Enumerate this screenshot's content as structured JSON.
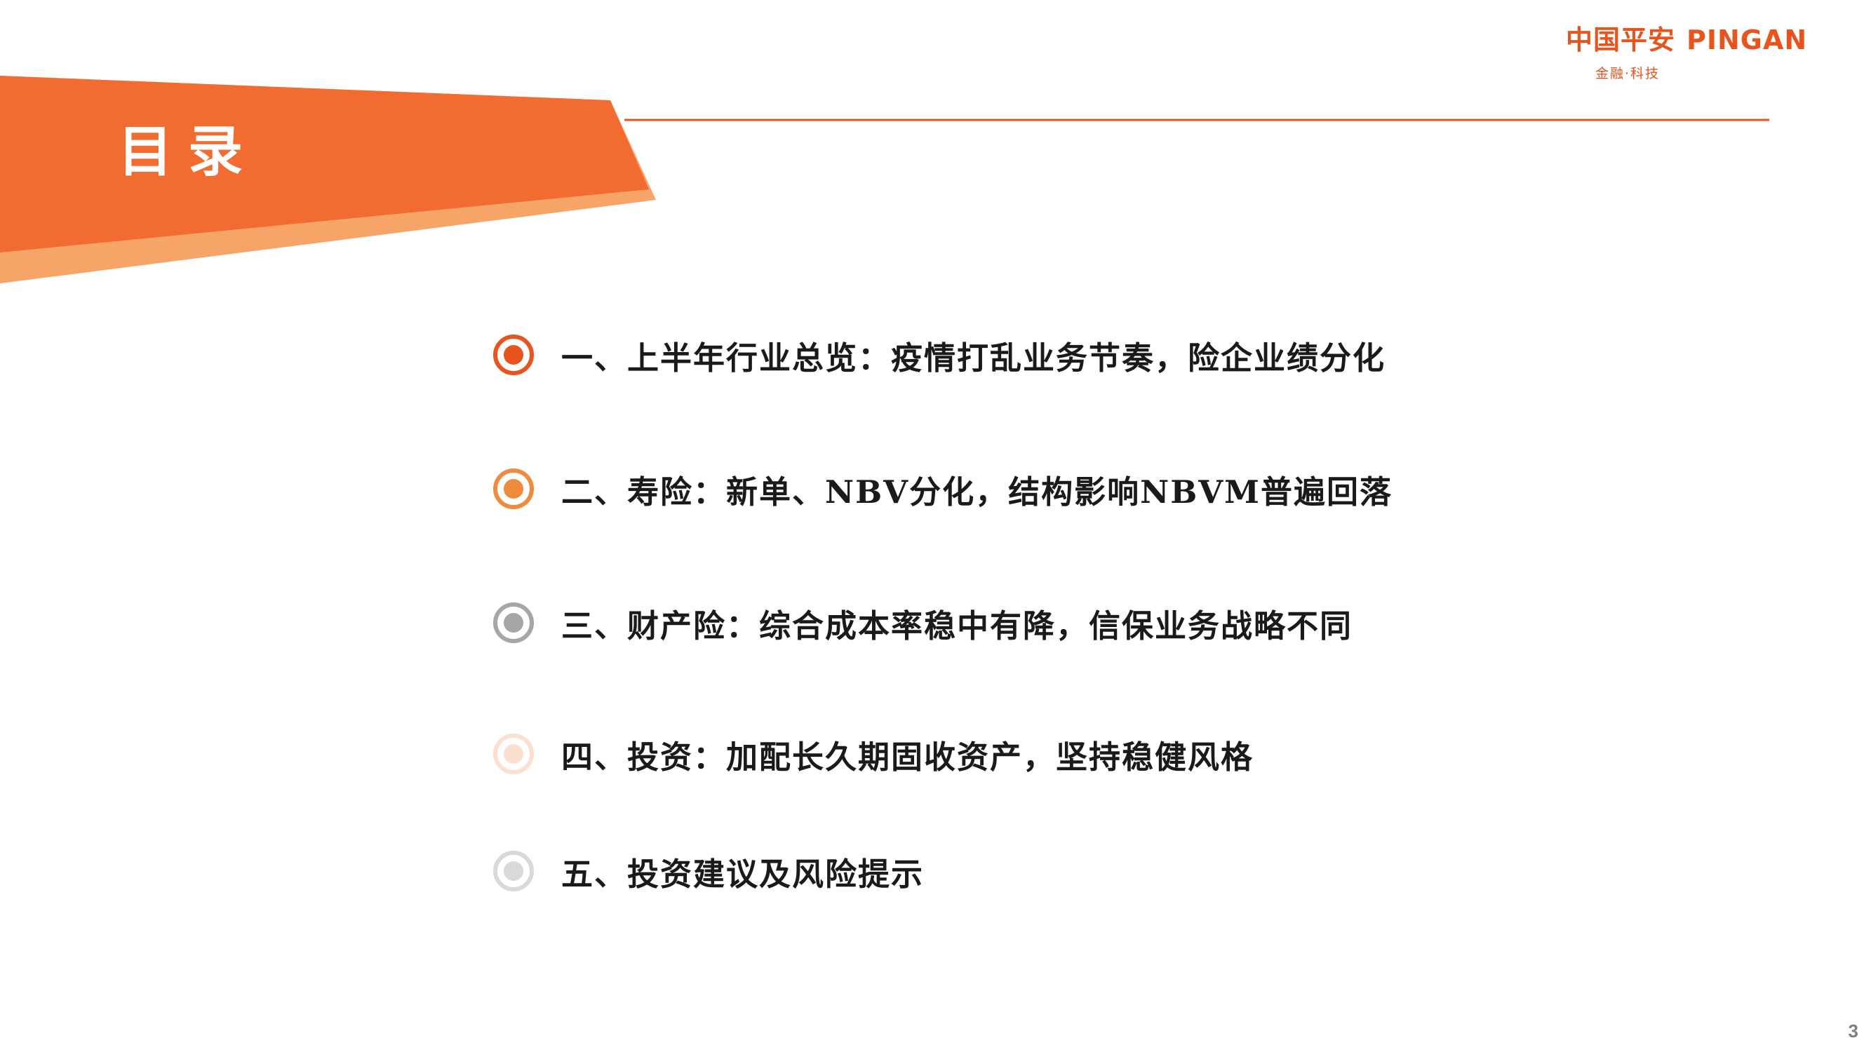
{
  "slide": {
    "title": "目录",
    "page_number": "3"
  },
  "logo": {
    "cn": "中国平安",
    "en": "PINGAN",
    "tagline": "金融·科技",
    "color": "#e8541e"
  },
  "colors": {
    "accent_orange": "#f26b30",
    "light_orange": "#f7a468",
    "divider": "#e8541e"
  },
  "toc": {
    "items": [
      {
        "label": "一、上半年行业总览：疫情打乱业务节奏，险企业绩分化",
        "ring_color": "#e8541e",
        "dot_color": "#e8541e"
      },
      {
        "label": "二、寿险：新单、NBV分化，结构影响NBVM普遍回落",
        "ring_color": "#f08a3c",
        "dot_color": "#f08a3c"
      },
      {
        "label": "三、财产险：综合成本率稳中有降，信保业务战略不同",
        "ring_color": "#a6a6a6",
        "dot_color": "#a6a6a6"
      },
      {
        "label": "四、投资：加配长久期固收资产，坚持稳健风格",
        "ring_color": "#fbe0cf",
        "dot_color": "#fbe0cf"
      },
      {
        "label": "五、投资建议及风险提示",
        "ring_color": "#d9d9d9",
        "dot_color": "#d9d9d9"
      }
    ]
  }
}
